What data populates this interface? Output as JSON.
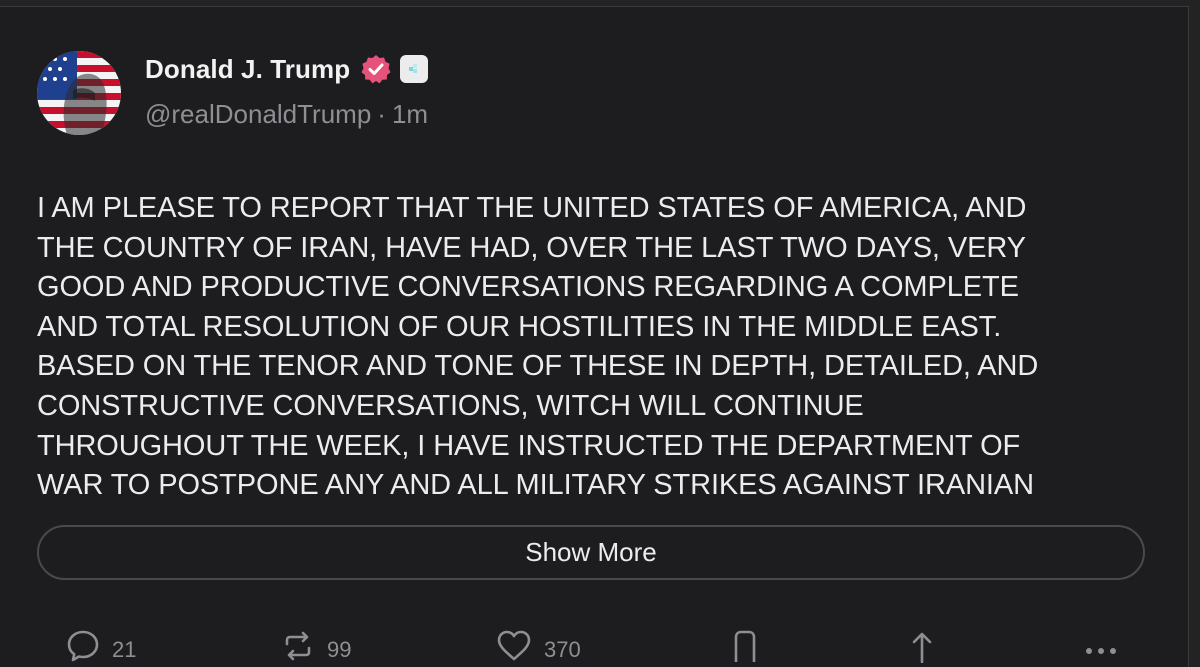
{
  "post": {
    "author": {
      "display_name": "Donald J. Trump",
      "handle": "@realDonaldTrump",
      "timestamp": "1m",
      "verified_color": "#e5527a"
    },
    "text": "I AM PLEASE TO REPORT THAT THE UNITED STATES OF AMERICA, AND\nTHE COUNTRY OF IRAN, HAVE HAD, OVER THE LAST TWO DAYS, VERY\nGOOD AND PRODUCTIVE CONVERSATIONS REGARDING A COMPLETE\nAND TOTAL RESOLUTION OF OUR HOSTILITIES IN THE MIDDLE EAST.\nBASED ON THE TENOR AND TONE OF THESE IN DEPTH, DETAILED, AND\nCONSTRUCTIVE CONVERSATIONS, WITCH WILL CONTINUE\nTHROUGHOUT THE WEEK, I HAVE INSTRUCTED THE DEPARTMENT OF\nWAR TO POSTPONE ANY AND ALL MILITARY STRIKES AGAINST IRANIAN",
    "show_more_label": "Show More"
  },
  "actions": {
    "replies": "21",
    "reposts": "99",
    "likes": "370",
    "icons": [
      "reply-icon",
      "repost-icon",
      "like-icon",
      "bookmark-icon",
      "share-icon",
      "more-icon"
    ]
  }
}
